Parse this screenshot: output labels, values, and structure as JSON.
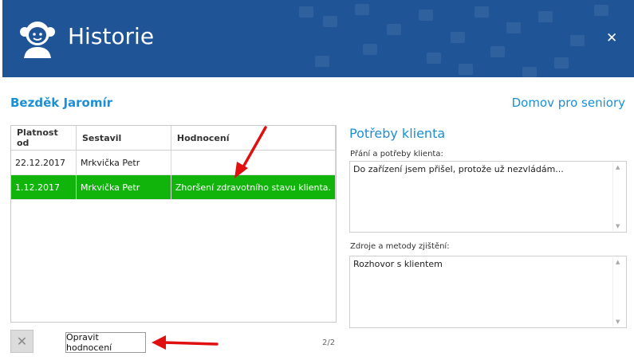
{
  "window": {
    "title": "Historie",
    "close_symbol": "✕"
  },
  "client": {
    "name": "Bezděk Jaromír",
    "facility": "Domov pro seniory"
  },
  "table": {
    "headers": [
      "Platnost od",
      "Sestavil",
      "Hodnocení"
    ],
    "rows": [
      [
        "22.12.2017",
        "Mrkvička Petr",
        ""
      ],
      [
        "1.12.2017",
        "Mrkvička Petr",
        "Zhoršení zdravotního stavu klienta."
      ]
    ],
    "selected_row": 1
  },
  "actions": {
    "delete_symbol": "✕",
    "fix_label": "Opravit hodnocení",
    "pager": "2/2"
  },
  "needs": {
    "title": "Potřeby klienta",
    "wishes_label": "Přání a potřeby klienta:",
    "wishes_value": "Do zařízení jsem přišel, protože už nezvládám...",
    "sources_label": "Zdroje a metody zjištění:",
    "sources_value": "Rozhovor s klientem"
  },
  "colors": {
    "titlebar": "#1f5597",
    "accent": "#1b8fd6",
    "selection": "#10b40a",
    "annotation": "#e01010"
  }
}
